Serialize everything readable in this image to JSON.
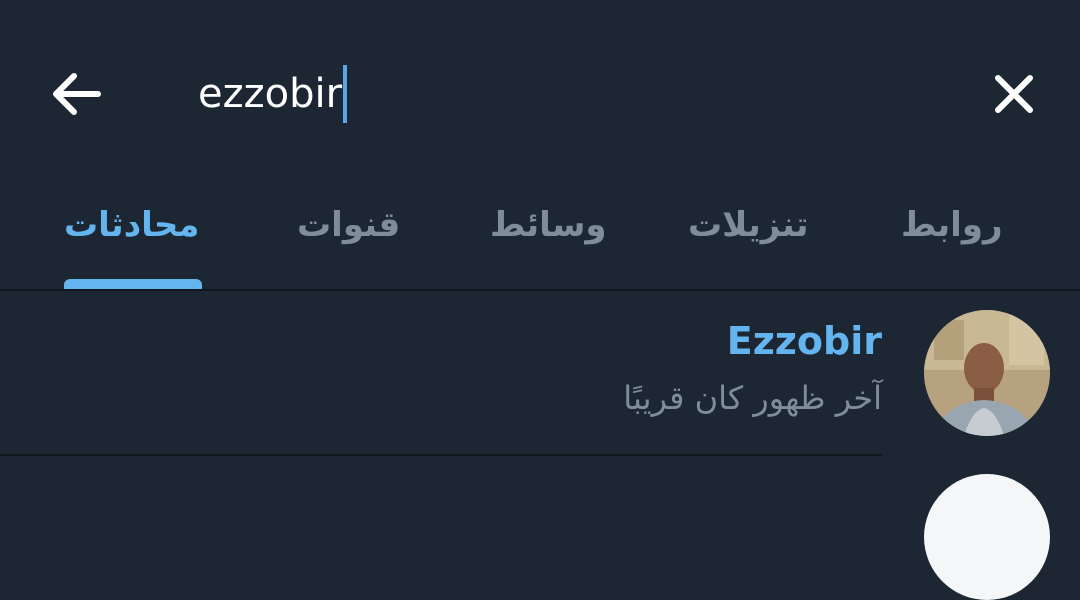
{
  "header": {
    "back_icon": "arrow-left-icon",
    "search_value": "ezzobir",
    "close_icon": "close-icon"
  },
  "tabs": [
    {
      "label": "محادثات",
      "active": true
    },
    {
      "label": "قنوات",
      "active": false
    },
    {
      "label": "وسائط",
      "active": false
    },
    {
      "label": "تنزيلات",
      "active": false
    },
    {
      "label": "روابط",
      "active": false
    }
  ],
  "results": [
    {
      "name": "Ezzobir",
      "status": "آخر ظهور كان قريبًا",
      "avatar_icon": "user-photo"
    }
  ],
  "colors": {
    "background": "#1d2733",
    "accent": "#64b5ef",
    "muted_text": "#818c99",
    "caret": "#5aa6e8"
  }
}
